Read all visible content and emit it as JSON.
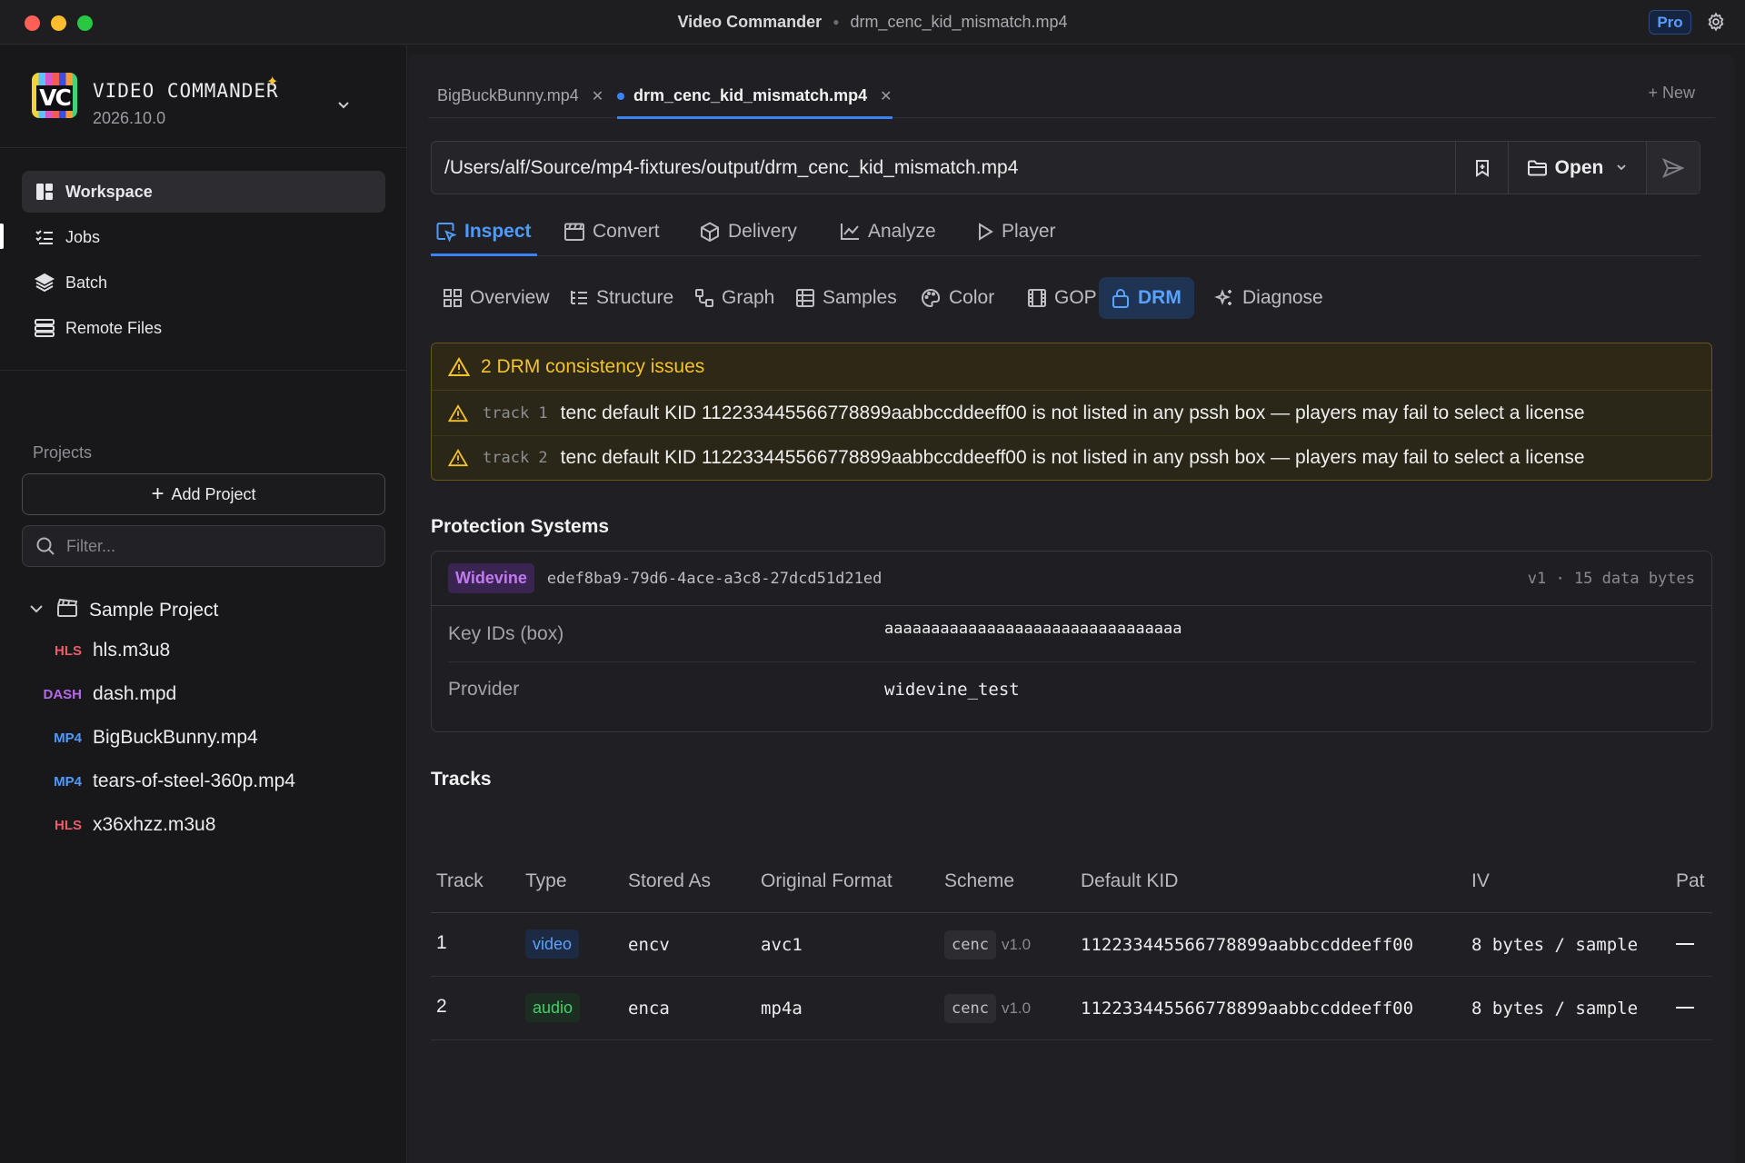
{
  "window": {
    "app_title": "Video Commander",
    "file_title": "drm_cenc_kid_mismatch.mp4",
    "pro_badge": "Pro"
  },
  "brand": {
    "name": "VIDEO COMMANDER",
    "logo_text": "VC",
    "version": "2026.10.0"
  },
  "nav": [
    {
      "label": "Workspace",
      "icon": "workspace-icon",
      "active": true
    },
    {
      "label": "Jobs",
      "icon": "jobs-icon"
    },
    {
      "label": "Batch",
      "icon": "layers-icon"
    },
    {
      "label": "Remote Files",
      "icon": "server-icon"
    }
  ],
  "projects": {
    "label": "Projects",
    "add_label": "Add Project",
    "filter_placeholder": "Filter...",
    "root": "Sample Project",
    "items": [
      {
        "badge": "HLS",
        "name": "hls.m3u8",
        "color": "#ef5b6a"
      },
      {
        "badge": "DASH",
        "name": "dash.mpd",
        "color": "#b46ae8"
      },
      {
        "badge": "MP4",
        "name": "BigBuckBunny.mp4",
        "color": "#4d9bff"
      },
      {
        "badge": "MP4",
        "name": "tears-of-steel-360p.mp4",
        "color": "#4d9bff"
      },
      {
        "badge": "HLS",
        "name": "x36xhzz.m3u8",
        "color": "#ef5b6a"
      }
    ]
  },
  "file_tabs": [
    {
      "label": "BigBuckBunny.mp4",
      "active": false
    },
    {
      "label": "drm_cenc_kid_mismatch.mp4",
      "active": true
    }
  ],
  "new_tab_label": "+ New",
  "path": {
    "value": "/Users/alf/Source/mp4-fixtures/output/drm_cenc_kid_mismatch.mp4",
    "open_label": "Open"
  },
  "mode_tabs": [
    {
      "label": "Inspect",
      "active": true
    },
    {
      "label": "Convert"
    },
    {
      "label": "Delivery"
    },
    {
      "label": "Analyze"
    },
    {
      "label": "Player"
    }
  ],
  "sub_tabs": [
    {
      "label": "Overview"
    },
    {
      "label": "Structure"
    },
    {
      "label": "Graph"
    },
    {
      "label": "Samples"
    },
    {
      "label": "Color"
    },
    {
      "label": "GOP"
    },
    {
      "label": "DRM",
      "active": true
    },
    {
      "label": "Diagnose"
    }
  ],
  "alert": {
    "title": "2 DRM consistency issues",
    "color": "#f4c22b",
    "issues": [
      {
        "track": "track 1",
        "message": "tenc default KID 112233445566778899aabbccddeeff00 is not listed in any pssh box — players may fail to select a license"
      },
      {
        "track": "track 2",
        "message": "tenc default KID 112233445566778899aabbccddeeff00 is not listed in any pssh box — players may fail to select a license"
      }
    ]
  },
  "protection": {
    "heading": "Protection Systems",
    "system_name": "Widevine",
    "system_id": "edef8ba9-79d6-4ace-a3c8-27dcd51d21ed",
    "meta": "v1 · 15 data bytes",
    "key_ids_label": "Key IDs (box)",
    "key_ids_value": "aaaaaaaaaaaaaaaaaaaaaaaaaaaaaaaa",
    "provider_label": "Provider",
    "provider_value": "widevine_test"
  },
  "tracks": {
    "heading": "Tracks",
    "columns": [
      "Track",
      "Type",
      "Stored As",
      "Original Format",
      "Scheme",
      "Default KID",
      "IV",
      "Pat"
    ],
    "rows": [
      {
        "track": "1",
        "type": "video",
        "stored_as": "encv",
        "original_format": "avc1",
        "scheme": "cenc",
        "scheme_version": "v1.0",
        "default_kid": "112233445566778899aabbccddeeff00",
        "iv": "8 bytes / sample",
        "pattern": "—"
      },
      {
        "track": "2",
        "type": "audio",
        "stored_as": "enca",
        "original_format": "mp4a",
        "scheme": "cenc",
        "scheme_version": "v1.0",
        "default_kid": "112233445566778899aabbccddeeff00",
        "iv": "8 bytes / sample",
        "pattern": "—"
      }
    ]
  }
}
